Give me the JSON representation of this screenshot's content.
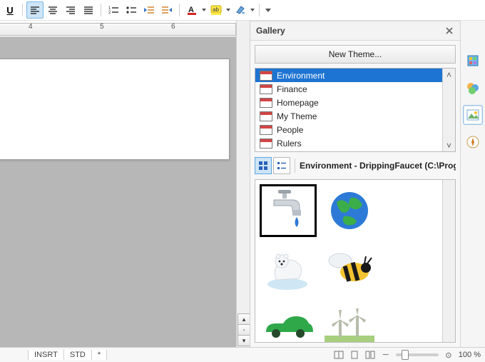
{
  "toolbar": {
    "underline_letter": "U"
  },
  "ruler": {
    "num4": "4",
    "num5": "5",
    "num6": "6"
  },
  "gallery": {
    "title": "Gallery",
    "new_theme_label": "New Theme...",
    "themes": [
      {
        "label": "Environment",
        "selected": true
      },
      {
        "label": "Finance"
      },
      {
        "label": "Homepage"
      },
      {
        "label": "My Theme"
      },
      {
        "label": "People"
      },
      {
        "label": "Rulers"
      }
    ],
    "current_path": "Environment - DrippingFaucet (C:\\Prog",
    "thumbs": [
      {
        "name": "dripping-faucet"
      },
      {
        "name": "earth-globe"
      },
      {
        "name": "polar-bear"
      },
      {
        "name": "bee"
      },
      {
        "name": "green-car"
      },
      {
        "name": "wind-turbine"
      }
    ]
  },
  "status": {
    "cells": [
      "INSRT",
      "STD",
      "*"
    ],
    "zoom": "100 %"
  }
}
